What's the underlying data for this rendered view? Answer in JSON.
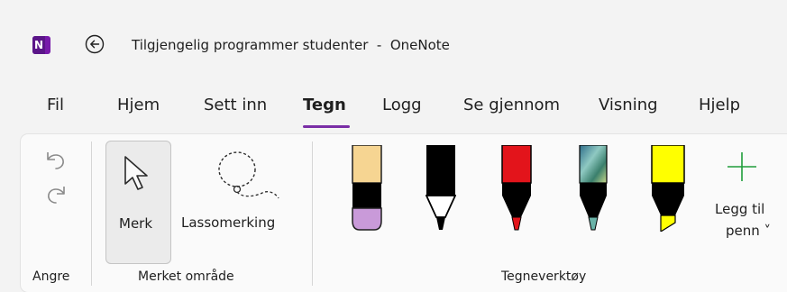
{
  "window": {
    "title": "Tilgjengelig programmer studenter  -  OneNote",
    "app_icon_letter": "N",
    "brand_color": "#7719aa"
  },
  "tabs": [
    {
      "label": "Fil",
      "active": false
    },
    {
      "label": "Hjem",
      "active": false
    },
    {
      "label": "Sett inn",
      "active": false
    },
    {
      "label": "Tegn",
      "active": true
    },
    {
      "label": "Logg",
      "active": false
    },
    {
      "label": "Se gjennom",
      "active": false
    },
    {
      "label": "Visning",
      "active": false
    },
    {
      "label": "Hjelp",
      "active": false
    }
  ],
  "ribbon": {
    "undo_group": {
      "label": "Angre",
      "undo_icon": "undo-icon",
      "redo_icon": "redo-icon"
    },
    "selection_group": {
      "label": "Merket område",
      "merk_label": "Merk",
      "lasso_label": "Lassomerking"
    },
    "tools_group": {
      "label": "Tegneverktøy",
      "pens": [
        {
          "name": "eraser-pen",
          "body_color": "#f6d592",
          "tip_color": "#c99ad9"
        },
        {
          "name": "black-pen",
          "body_color": "#000000",
          "tip_color": "#000000"
        },
        {
          "name": "red-pen",
          "body_color": "#e3141b",
          "tip_color": "#e3141b"
        },
        {
          "name": "galaxy-pen",
          "body_color": "#4f8f9a",
          "tip_color": "#6ab3a8"
        },
        {
          "name": "yellow-highlighter",
          "body_color": "#ffff00",
          "tip_color": "#ffff00"
        }
      ],
      "add_pen_line1": "Legg til",
      "add_pen_line2": "penn ˅",
      "add_color": "#1f9d3a"
    }
  }
}
